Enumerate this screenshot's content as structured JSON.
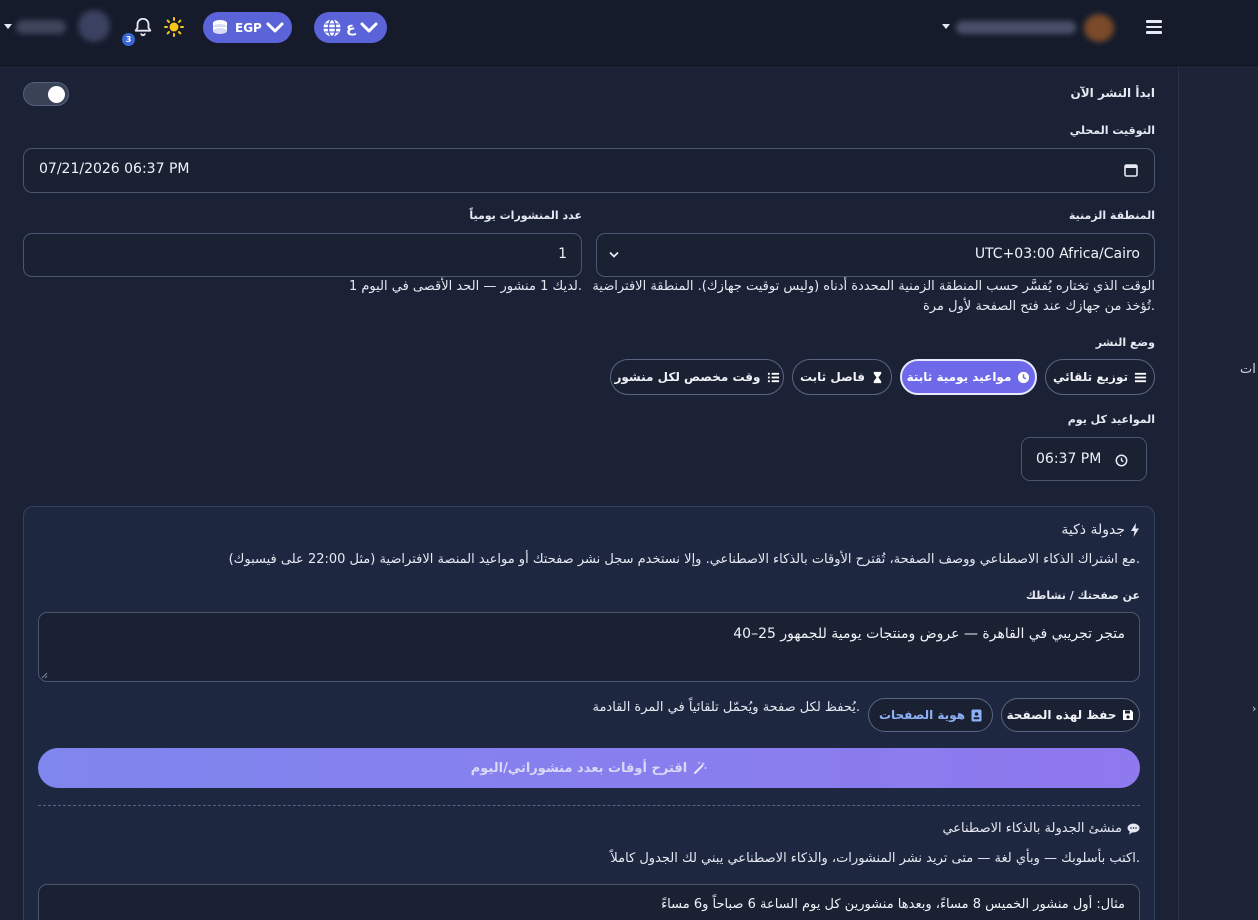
{
  "topbar": {
    "notification_count": "3",
    "currency_label": "EGP",
    "language_label": "ع"
  },
  "publish_now": {
    "label": "ابدأ النشر الآن",
    "enabled": true
  },
  "local_time": {
    "label": "التوقيت المحلي",
    "value": "07/21/2026 06:37 PM"
  },
  "timezone": {
    "label": "المنطقة الزمنية",
    "value": "UTC+03:00 Africa/Cairo",
    "help_line1": "الوقت الذي تختاره يُفسَّر حسب المنطقة الزمنية المحددة أدناه (وليس توقيت جهازك). المنطقة الافتراضية",
    "help_line2": "تُؤخذ من جهازك عند فتح الصفحة لأول مرة."
  },
  "posts_per_day": {
    "label": "عدد المنشورات يومياً",
    "value": "1",
    "help": "لديك 1 منشور — الحد الأقصى في اليوم 1."
  },
  "publish_mode": {
    "label": "وضع النشر",
    "options": [
      {
        "label": "توزيع تلقائي",
        "icon": "list-icon",
        "active": false
      },
      {
        "label": "مواعيد يومية ثابتة",
        "icon": "clock-icon",
        "active": true
      },
      {
        "label": "فاصل ثابت",
        "icon": "hourglass-icon",
        "active": false
      },
      {
        "label": "وقت مخصص لكل منشور",
        "icon": "list-ordered-icon",
        "active": false
      }
    ]
  },
  "daily_times": {
    "label": "المواعيد كل يوم",
    "value": "06:37 PM"
  },
  "smart_schedule": {
    "title": "جدولة ذكية",
    "description": "مع اشتراك الذكاء الاصطناعي ووصف الصفحة، تُقترح الأوقات بالذكاء الاصطناعي. وإلا نستخدم سجل نشر صفحتك أو مواعيد المنصة الافتراضية (مثل 22:00 على فيسبوك).",
    "about_label": "عن صفحتك / نشاطك",
    "about_value": "متجر تجريبي في القاهرة — عروض ومنتجات يومية للجمهور 25–40",
    "save_button": "حفظ لهذه الصفحة",
    "identity_button": "هوية الصفحات",
    "save_note": "يُحفظ لكل صفحة ويُحمّل تلقائياً في المرة القادمة.",
    "suggest_button": "اقترح أوقات بعدد منشوراتي/اليوم"
  },
  "ai_builder": {
    "title": "منشئ الجدولة بالذكاء الاصطناعي",
    "description": "اكتب بأسلوبك — وبأي لغة — متى تريد نشر المنشورات، والذكاء الاصطناعي يبني لك الجدول كاملاً.",
    "input_value": "مثال: أول منشور الخميس 8 مساءً، وبعدها منشورين كل يوم الساعة 6 صباحاً و6 مساءً"
  },
  "side_panel": {
    "fragment_text": "ات"
  },
  "colors": {
    "accent": "#6d69e8",
    "background": "#1b2236",
    "topbar": "#151b2b"
  }
}
